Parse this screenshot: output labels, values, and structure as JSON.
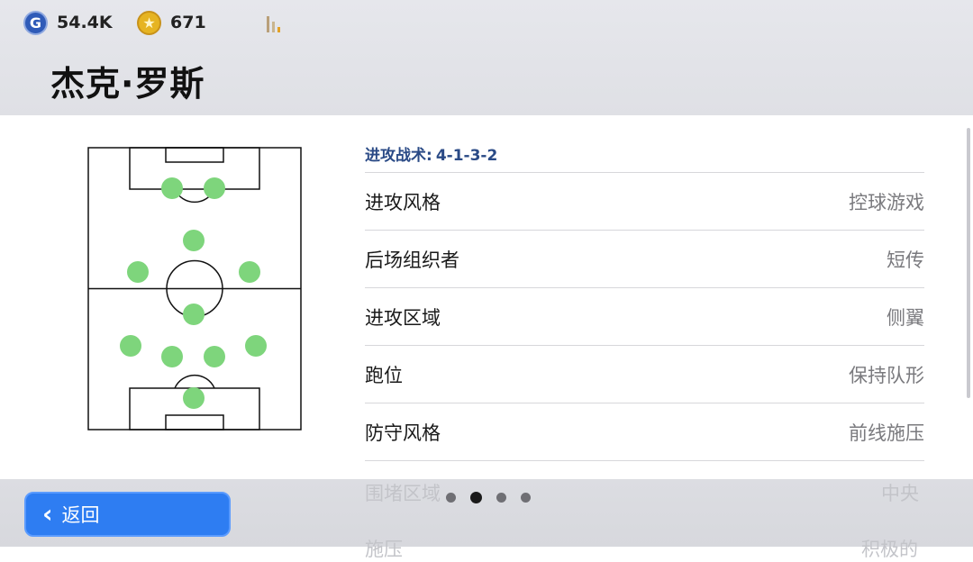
{
  "currency": {
    "g_icon": "G",
    "g_amount": "54.4K",
    "coin_icon": "★",
    "coin_amount": "671"
  },
  "player": {
    "name": "杰克·罗斯"
  },
  "tactics": {
    "label": "进攻战术:",
    "formation": "4-1-3-2"
  },
  "settings": [
    {
      "label": "进攻风格",
      "value": "控球游戏"
    },
    {
      "label": "后场组织者",
      "value": "短传"
    },
    {
      "label": "进攻区域",
      "value": "侧翼"
    },
    {
      "label": "跑位",
      "value": "保持队形"
    },
    {
      "label": "防守风格",
      "value": "前线施压"
    }
  ],
  "partially_visible": {
    "label": "围堵区域",
    "value": "中央",
    "next_label": "施压",
    "next_value": "积极的"
  },
  "footer": {
    "back_label": "返回"
  },
  "pager": {
    "pages": 4,
    "active_page": 2
  },
  "colors": {
    "player_dot": "#7ed57c",
    "button": "#2e7df2",
    "tactics_text": "#2a4a86"
  }
}
